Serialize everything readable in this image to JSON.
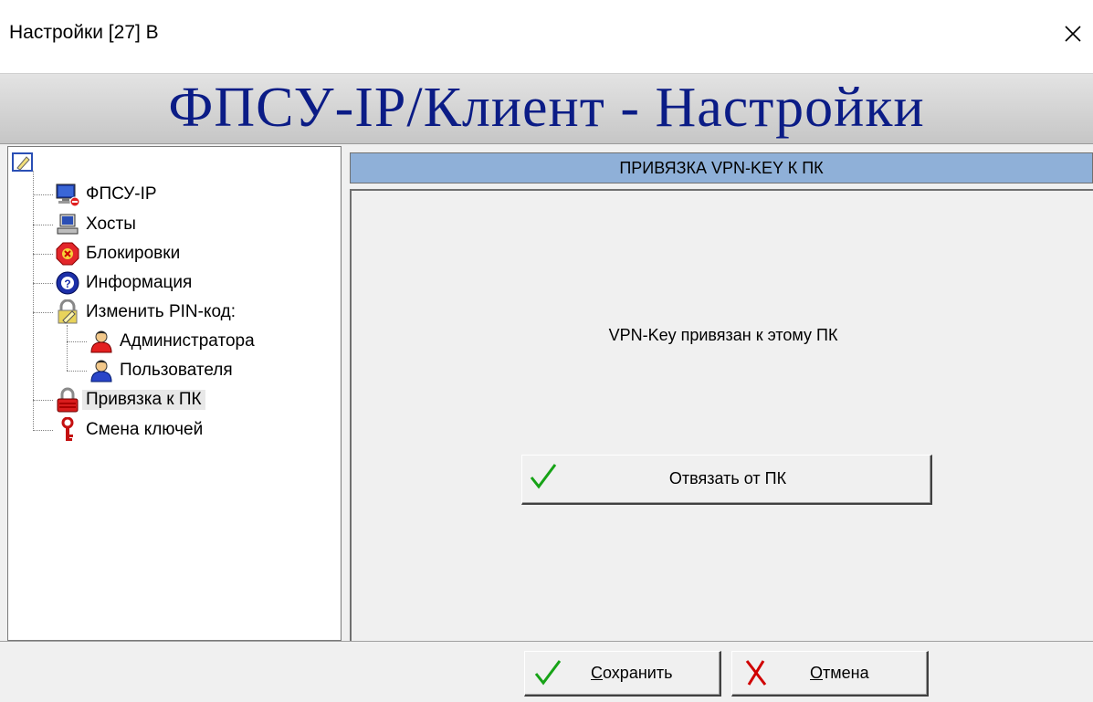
{
  "window": {
    "title": "Настройки [27] В",
    "close_icon": "close-icon"
  },
  "header": {
    "title": "ФПСУ-IP/Клиент - Настройки",
    "title_color": "#0b1c86"
  },
  "tree": {
    "items": [
      {
        "label": "ФПСУ-IP",
        "icon": "monitor-icon"
      },
      {
        "label": "Хосты",
        "icon": "computer-icon"
      },
      {
        "label": "Блокировки",
        "icon": "block-icon"
      },
      {
        "label": "Информация",
        "icon": "info-icon"
      },
      {
        "label": "Изменить PIN-код:",
        "icon": "edit-icon"
      },
      {
        "label": "Администратора",
        "icon": "admin-user-icon"
      },
      {
        "label": "Пользователя",
        "icon": "user-icon"
      },
      {
        "label": "Привязка к ПК",
        "icon": "lock-icon",
        "selected": true
      },
      {
        "label": "Смена ключей",
        "icon": "key-icon"
      }
    ]
  },
  "section": {
    "header": "ПРИВЯЗКА VPN-KEY К ПК",
    "header_color": "#8fb0d8",
    "status": "VPN-Key привязан к этому ПК",
    "unbind_label": "Отвязать от ПК"
  },
  "footer": {
    "save_first": "С",
    "save_rest": "охранить",
    "cancel_first": "О",
    "cancel_rest": "тмена"
  }
}
